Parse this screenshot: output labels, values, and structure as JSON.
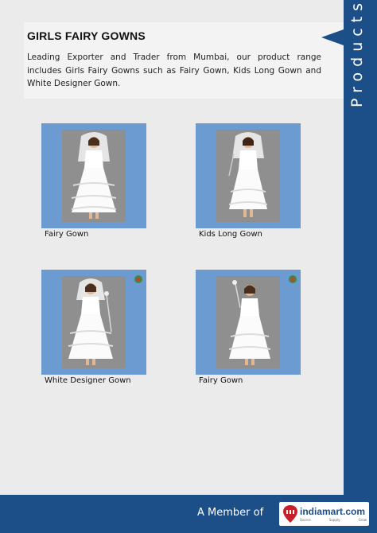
{
  "header": {
    "title": "GIRLS FAIRY GOWNS",
    "intro": "Leading Exporter and Trader from Mumbai, our product range includes Girls Fairy Gowns such as Fairy Gown, Kids Long Gown and White Designer Gown."
  },
  "side_tab": {
    "label": "Products"
  },
  "products": [
    {
      "caption": "Fairy Gown"
    },
    {
      "caption": "Kids Long Gown"
    },
    {
      "caption": "White Designer Gown"
    },
    {
      "caption": "Fairy Gown"
    }
  ],
  "footer": {
    "member_text": "A Member of",
    "logo_name": "indiamart.com",
    "logo_tagline": [
      "Source",
      "Supply",
      "Grow"
    ]
  },
  "colors": {
    "brand_blue": "#1c4e87",
    "photo_frame": "#6b9bd1",
    "page_bg": "#ebebeb"
  }
}
